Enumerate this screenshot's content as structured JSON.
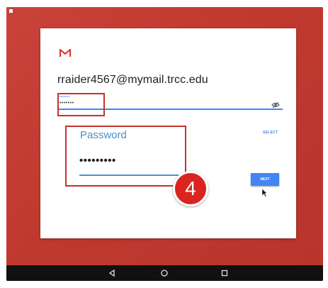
{
  "app": {
    "account_email": "rraider4567@mymail.trcc.edu"
  },
  "password_field": {
    "label": "Password",
    "masked_value": "••••••••"
  },
  "zoom_callout": {
    "label": "Password",
    "masked_value": "•••••••••"
  },
  "actions": {
    "select_label": "SELECT",
    "next_label": "NEXT"
  },
  "annotation": {
    "step_number": "4"
  },
  "colors": {
    "brand_red": "#c5312b",
    "accent_blue": "#4285f4",
    "wallpaper": "#c0392f"
  },
  "icons": [
    "gmail-m-icon",
    "eye-icon",
    "cursor-icon",
    "back-icon",
    "home-icon",
    "recents-icon"
  ]
}
